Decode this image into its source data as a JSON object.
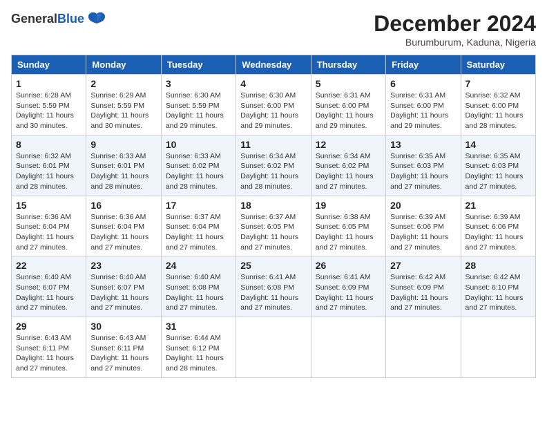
{
  "header": {
    "logo_general": "General",
    "logo_blue": "Blue",
    "month_title": "December 2024",
    "location": "Burumburum, Kaduna, Nigeria"
  },
  "columns": [
    "Sunday",
    "Monday",
    "Tuesday",
    "Wednesday",
    "Thursday",
    "Friday",
    "Saturday"
  ],
  "weeks": [
    [
      {
        "day": "1",
        "info": "Sunrise: 6:28 AM\nSunset: 5:59 PM\nDaylight: 11 hours and 30 minutes."
      },
      {
        "day": "2",
        "info": "Sunrise: 6:29 AM\nSunset: 5:59 PM\nDaylight: 11 hours and 30 minutes."
      },
      {
        "day": "3",
        "info": "Sunrise: 6:30 AM\nSunset: 5:59 PM\nDaylight: 11 hours and 29 minutes."
      },
      {
        "day": "4",
        "info": "Sunrise: 6:30 AM\nSunset: 6:00 PM\nDaylight: 11 hours and 29 minutes."
      },
      {
        "day": "5",
        "info": "Sunrise: 6:31 AM\nSunset: 6:00 PM\nDaylight: 11 hours and 29 minutes."
      },
      {
        "day": "6",
        "info": "Sunrise: 6:31 AM\nSunset: 6:00 PM\nDaylight: 11 hours and 29 minutes."
      },
      {
        "day": "7",
        "info": "Sunrise: 6:32 AM\nSunset: 6:00 PM\nDaylight: 11 hours and 28 minutes."
      }
    ],
    [
      {
        "day": "8",
        "info": "Sunrise: 6:32 AM\nSunset: 6:01 PM\nDaylight: 11 hours and 28 minutes."
      },
      {
        "day": "9",
        "info": "Sunrise: 6:33 AM\nSunset: 6:01 PM\nDaylight: 11 hours and 28 minutes."
      },
      {
        "day": "10",
        "info": "Sunrise: 6:33 AM\nSunset: 6:02 PM\nDaylight: 11 hours and 28 minutes."
      },
      {
        "day": "11",
        "info": "Sunrise: 6:34 AM\nSunset: 6:02 PM\nDaylight: 11 hours and 28 minutes."
      },
      {
        "day": "12",
        "info": "Sunrise: 6:34 AM\nSunset: 6:02 PM\nDaylight: 11 hours and 27 minutes."
      },
      {
        "day": "13",
        "info": "Sunrise: 6:35 AM\nSunset: 6:03 PM\nDaylight: 11 hours and 27 minutes."
      },
      {
        "day": "14",
        "info": "Sunrise: 6:35 AM\nSunset: 6:03 PM\nDaylight: 11 hours and 27 minutes."
      }
    ],
    [
      {
        "day": "15",
        "info": "Sunrise: 6:36 AM\nSunset: 6:04 PM\nDaylight: 11 hours and 27 minutes."
      },
      {
        "day": "16",
        "info": "Sunrise: 6:36 AM\nSunset: 6:04 PM\nDaylight: 11 hours and 27 minutes."
      },
      {
        "day": "17",
        "info": "Sunrise: 6:37 AM\nSunset: 6:04 PM\nDaylight: 11 hours and 27 minutes."
      },
      {
        "day": "18",
        "info": "Sunrise: 6:37 AM\nSunset: 6:05 PM\nDaylight: 11 hours and 27 minutes."
      },
      {
        "day": "19",
        "info": "Sunrise: 6:38 AM\nSunset: 6:05 PM\nDaylight: 11 hours and 27 minutes."
      },
      {
        "day": "20",
        "info": "Sunrise: 6:39 AM\nSunset: 6:06 PM\nDaylight: 11 hours and 27 minutes."
      },
      {
        "day": "21",
        "info": "Sunrise: 6:39 AM\nSunset: 6:06 PM\nDaylight: 11 hours and 27 minutes."
      }
    ],
    [
      {
        "day": "22",
        "info": "Sunrise: 6:40 AM\nSunset: 6:07 PM\nDaylight: 11 hours and 27 minutes."
      },
      {
        "day": "23",
        "info": "Sunrise: 6:40 AM\nSunset: 6:07 PM\nDaylight: 11 hours and 27 minutes."
      },
      {
        "day": "24",
        "info": "Sunrise: 6:40 AM\nSunset: 6:08 PM\nDaylight: 11 hours and 27 minutes."
      },
      {
        "day": "25",
        "info": "Sunrise: 6:41 AM\nSunset: 6:08 PM\nDaylight: 11 hours and 27 minutes."
      },
      {
        "day": "26",
        "info": "Sunrise: 6:41 AM\nSunset: 6:09 PM\nDaylight: 11 hours and 27 minutes."
      },
      {
        "day": "27",
        "info": "Sunrise: 6:42 AM\nSunset: 6:09 PM\nDaylight: 11 hours and 27 minutes."
      },
      {
        "day": "28",
        "info": "Sunrise: 6:42 AM\nSunset: 6:10 PM\nDaylight: 11 hours and 27 minutes."
      }
    ],
    [
      {
        "day": "29",
        "info": "Sunrise: 6:43 AM\nSunset: 6:11 PM\nDaylight: 11 hours and 27 minutes."
      },
      {
        "day": "30",
        "info": "Sunrise: 6:43 AM\nSunset: 6:11 PM\nDaylight: 11 hours and 27 minutes."
      },
      {
        "day": "31",
        "info": "Sunrise: 6:44 AM\nSunset: 6:12 PM\nDaylight: 11 hours and 28 minutes."
      },
      {
        "day": "",
        "info": ""
      },
      {
        "day": "",
        "info": ""
      },
      {
        "day": "",
        "info": ""
      },
      {
        "day": "",
        "info": ""
      }
    ]
  ]
}
